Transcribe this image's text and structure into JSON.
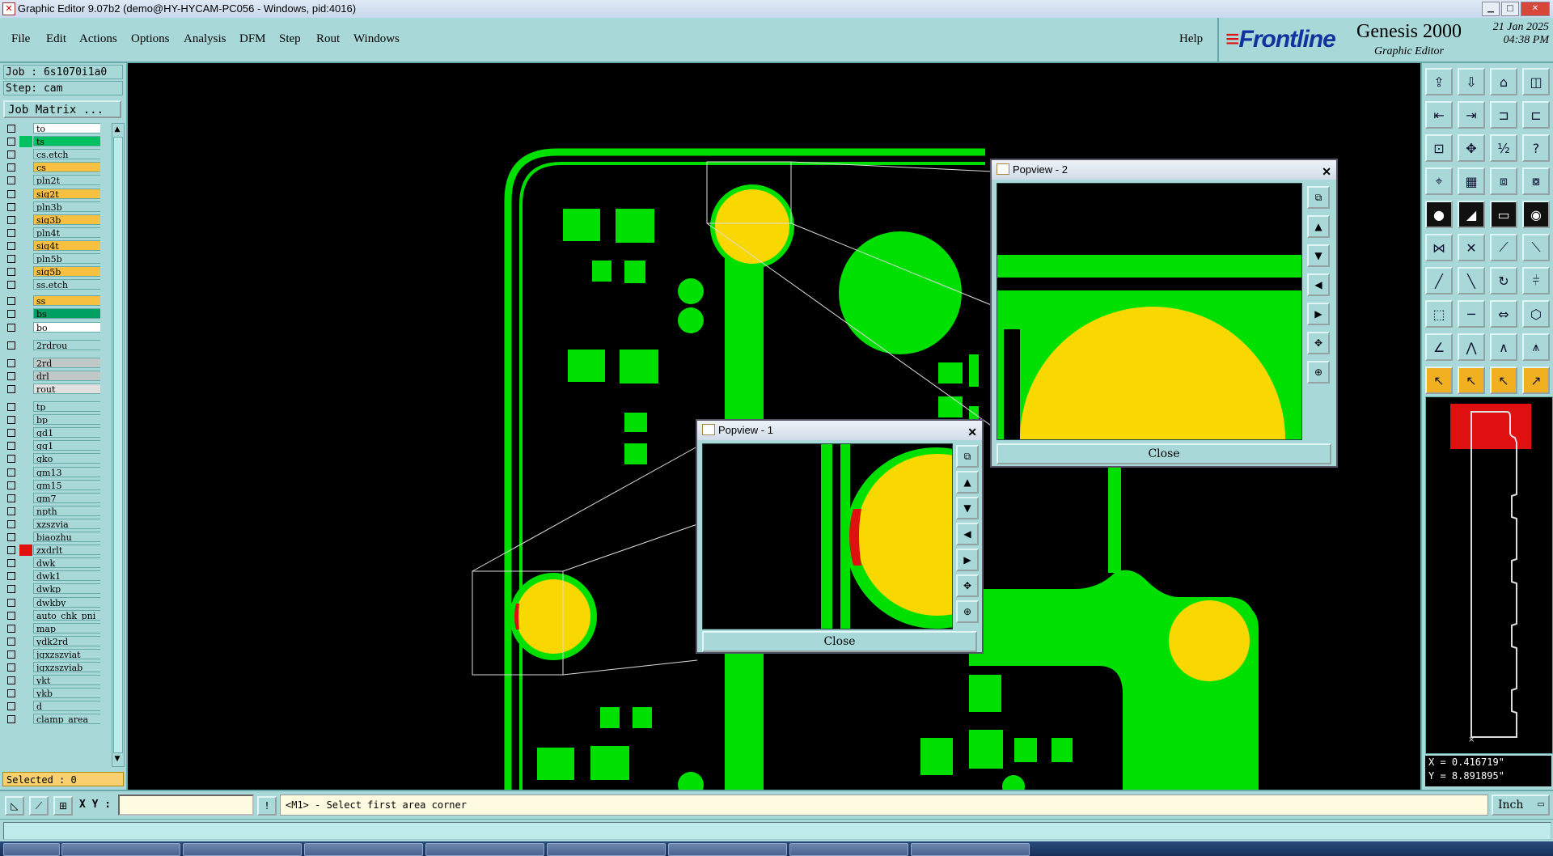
{
  "window": {
    "title": "Graphic Editor 9.07b2 (demo@HY-HYCAM-PC056 - Windows, pid:4016)"
  },
  "menu": [
    "File",
    "Edit",
    "Actions",
    "Options",
    "Analysis",
    "DFM",
    "Step",
    "Rout",
    "Windows"
  ],
  "help_label": "Help",
  "brand": {
    "logo": "Frontline",
    "product": "Genesis 2000",
    "subtitle": "Graphic Editor",
    "date": "21 Jan 2025",
    "time": "04:38 PM"
  },
  "job": {
    "job_line": "Job : 6s1070i1a0",
    "step_line": "Step: cam",
    "matrix_button": "Job Matrix ..."
  },
  "layers": [
    {
      "name": "to",
      "bg": "#ffffff",
      "color": ""
    },
    {
      "name": "ts",
      "bg": "#00c060",
      "color": "#00c060"
    },
    {
      "name": "cs.etch",
      "bg": "#a8d8d8",
      "color": ""
    },
    {
      "name": "cs",
      "bg": "#f8c040",
      "color": ""
    },
    {
      "name": "pln2t",
      "bg": "#a8d8d8",
      "color": ""
    },
    {
      "name": "sig2t",
      "bg": "#f8c040",
      "color": ""
    },
    {
      "name": "pln3b",
      "bg": "#a8d8d8",
      "color": ""
    },
    {
      "name": "sig3b",
      "bg": "#f8c040",
      "color": ""
    },
    {
      "name": "pln4t",
      "bg": "#a8d8d8",
      "color": ""
    },
    {
      "name": "sig4t",
      "bg": "#f8c040",
      "color": ""
    },
    {
      "name": "pln5b",
      "bg": "#a8d8d8",
      "color": ""
    },
    {
      "name": "sig5b",
      "bg": "#f8c040",
      "color": ""
    },
    {
      "name": "ss.etch",
      "bg": "#a8d8d8",
      "color": ""
    },
    {
      "name": "ss",
      "bg": "#f8c040",
      "color": ""
    },
    {
      "name": "bs",
      "bg": "#00a060",
      "color": ""
    },
    {
      "name": "bo",
      "bg": "#ffffff",
      "color": ""
    },
    {
      "name": "2rdrou",
      "bg": "#a8d8d8",
      "color": ""
    },
    {
      "name": "2rd",
      "bg": "#c0c8c8",
      "color": ""
    },
    {
      "name": "drl",
      "bg": "#c0c8c8",
      "color": ""
    },
    {
      "name": "rout",
      "bg": "#e0e0e0",
      "color": ""
    },
    {
      "name": "tp",
      "bg": "#a8d8d8",
      "color": ""
    },
    {
      "name": "bp",
      "bg": "#a8d8d8",
      "color": ""
    },
    {
      "name": "gd1",
      "bg": "#a8d8d8",
      "color": ""
    },
    {
      "name": "gg1",
      "bg": "#a8d8d8",
      "color": ""
    },
    {
      "name": "gko",
      "bg": "#a8d8d8",
      "color": ""
    },
    {
      "name": "gm13",
      "bg": "#a8d8d8",
      "color": ""
    },
    {
      "name": "gm15",
      "bg": "#a8d8d8",
      "color": ""
    },
    {
      "name": "gm7",
      "bg": "#a8d8d8",
      "color": ""
    },
    {
      "name": "npth",
      "bg": "#a8d8d8",
      "color": ""
    },
    {
      "name": "xzszvia",
      "bg": "#a8d8d8",
      "color": ""
    },
    {
      "name": "biaozhu",
      "bg": "#a8d8d8",
      "color": ""
    },
    {
      "name": "zxdrlt",
      "bg": "#a8d8d8",
      "color": "#e01010"
    },
    {
      "name": "dwk",
      "bg": "#a8d8d8",
      "color": ""
    },
    {
      "name": "dwk1",
      "bg": "#a8d8d8",
      "color": ""
    },
    {
      "name": "dwkp",
      "bg": "#a8d8d8",
      "color": ""
    },
    {
      "name": "dwkby",
      "bg": "#a8d8d8",
      "color": ""
    },
    {
      "name": "auto_chk_pni",
      "bg": "#a8d8d8",
      "color": ""
    },
    {
      "name": "map",
      "bg": "#a8d8d8",
      "color": ""
    },
    {
      "name": "ydk2rd",
      "bg": "#a8d8d8",
      "color": ""
    },
    {
      "name": "jgxzszviat",
      "bg": "#a8d8d8",
      "color": ""
    },
    {
      "name": "jgxzszviab",
      "bg": "#a8d8d8",
      "color": ""
    },
    {
      "name": "ykt",
      "bg": "#a8d8d8",
      "color": ""
    },
    {
      "name": "ykb",
      "bg": "#a8d8d8",
      "color": ""
    },
    {
      "name": "d",
      "bg": "#a8d8d8",
      "color": ""
    },
    {
      "name": "clamp_area",
      "bg": "#a8d8d8",
      "color": ""
    }
  ],
  "selected_label": "Selected : 0",
  "popview2": {
    "title": "Popview - 2",
    "close": "Close"
  },
  "popview1": {
    "title": "Popview - 1",
    "close": "Close"
  },
  "coords": {
    "x": "X = 0.416719\"",
    "y": "Y = 8.891895\""
  },
  "bottom": {
    "xy_label": "X Y :",
    "xy_value": "",
    "message": "<M1> - Select first area corner",
    "units": "Inch"
  },
  "colors": {
    "copper": "#00e000",
    "pad": "#f8d800",
    "drill": "#e01010",
    "panel": "#a8d8d8"
  }
}
